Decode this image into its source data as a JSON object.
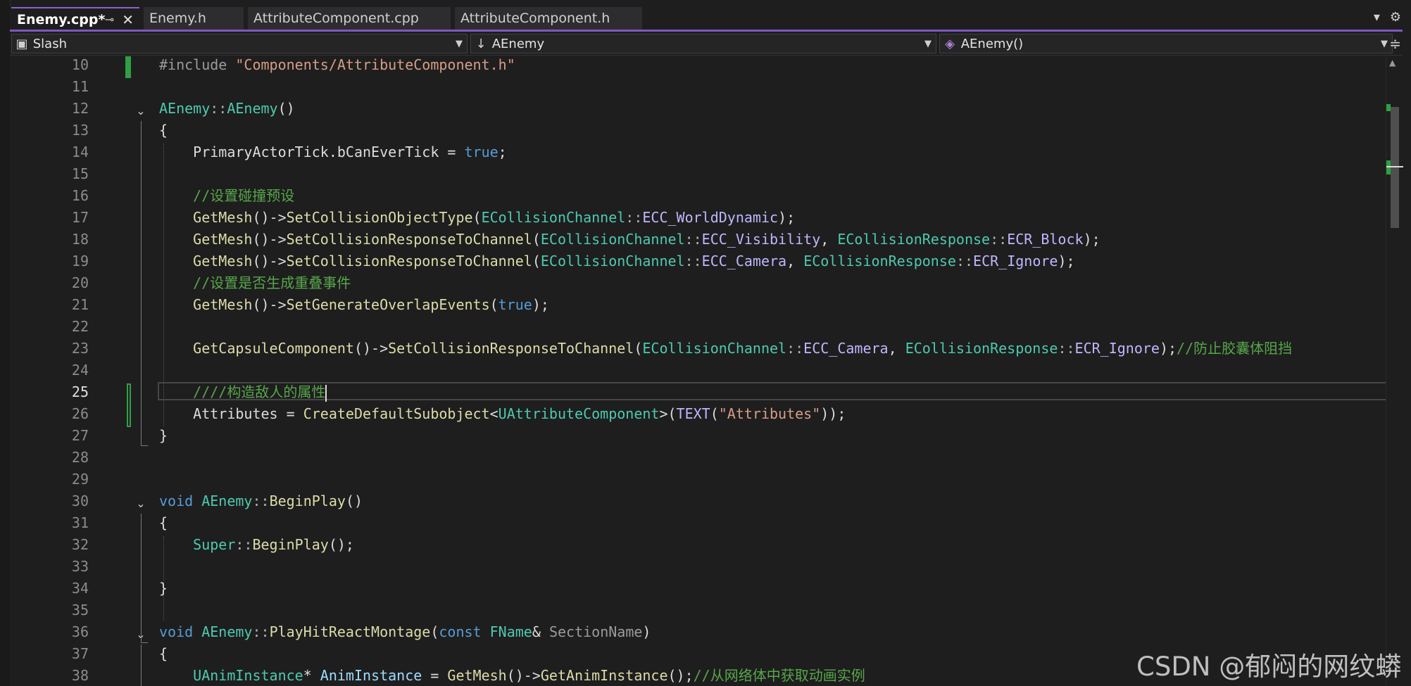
{
  "tabs": [
    {
      "label": "Enemy.cpp*",
      "active": true
    },
    {
      "label": "Enemy.h",
      "active": false
    },
    {
      "label": "AttributeComponent.cpp",
      "active": false
    },
    {
      "label": "AttributeComponent.h",
      "active": false
    }
  ],
  "tab_icons": {
    "pin": "pin-icon",
    "close": "close-icon",
    "overflow": "chevron-down-icon",
    "settings": "gear-icon"
  },
  "nav": {
    "project": "Slash",
    "scope": "AEnemy",
    "member": "AEnemy()"
  },
  "editor": {
    "current_line": 25,
    "lines": [
      {
        "n": 10,
        "tokens": [
          [
            "pr",
            "#include "
          ],
          [
            "s",
            "\"Components/AttributeComponent.h\""
          ]
        ]
      },
      {
        "n": 11,
        "tokens": []
      },
      {
        "n": 12,
        "tokens": [
          [
            "t",
            "AEnemy"
          ],
          [
            "op",
            "::"
          ],
          [
            "t",
            "AEnemy"
          ],
          [
            "p",
            "()"
          ]
        ]
      },
      {
        "n": 13,
        "tokens": [
          [
            "p",
            "{"
          ]
        ]
      },
      {
        "n": 14,
        "tokens": [
          [
            "p",
            "    PrimaryActorTick.bCanEverTick = "
          ],
          [
            "k",
            "true"
          ],
          [
            "p",
            ";"
          ]
        ]
      },
      {
        "n": 15,
        "tokens": []
      },
      {
        "n": 16,
        "tokens": [
          [
            "c",
            "    //设置碰撞预设"
          ]
        ]
      },
      {
        "n": 17,
        "tokens": [
          [
            "f",
            "    GetMesh"
          ],
          [
            "p",
            "()->"
          ],
          [
            "f",
            "SetCollisionObjectType"
          ],
          [
            "p",
            "("
          ],
          [
            "t",
            "ECollisionChannel"
          ],
          [
            "op",
            "::"
          ],
          [
            "m",
            "ECC_WorldDynamic"
          ],
          [
            "p",
            ");"
          ]
        ]
      },
      {
        "n": 18,
        "tokens": [
          [
            "f",
            "    GetMesh"
          ],
          [
            "p",
            "()->"
          ],
          [
            "f",
            "SetCollisionResponseToChannel"
          ],
          [
            "p",
            "("
          ],
          [
            "t",
            "ECollisionChannel"
          ],
          [
            "op",
            "::"
          ],
          [
            "m",
            "ECC_Visibility"
          ],
          [
            "p",
            ", "
          ],
          [
            "t",
            "ECollisionResponse"
          ],
          [
            "op",
            "::"
          ],
          [
            "m",
            "ECR_Block"
          ],
          [
            "p",
            ");"
          ]
        ]
      },
      {
        "n": 19,
        "tokens": [
          [
            "f",
            "    GetMesh"
          ],
          [
            "p",
            "()->"
          ],
          [
            "f",
            "SetCollisionResponseToChannel"
          ],
          [
            "p",
            "("
          ],
          [
            "t",
            "ECollisionChannel"
          ],
          [
            "op",
            "::"
          ],
          [
            "m",
            "ECC_Camera"
          ],
          [
            "p",
            ", "
          ],
          [
            "t",
            "ECollisionResponse"
          ],
          [
            "op",
            "::"
          ],
          [
            "m",
            "ECR_Ignore"
          ],
          [
            "p",
            ");"
          ]
        ]
      },
      {
        "n": 20,
        "tokens": [
          [
            "c",
            "    //设置是否生成重叠事件"
          ]
        ]
      },
      {
        "n": 21,
        "tokens": [
          [
            "f",
            "    GetMesh"
          ],
          [
            "p",
            "()->"
          ],
          [
            "f",
            "SetGenerateOverlapEvents"
          ],
          [
            "p",
            "("
          ],
          [
            "k",
            "true"
          ],
          [
            "p",
            ");"
          ]
        ]
      },
      {
        "n": 22,
        "tokens": []
      },
      {
        "n": 23,
        "tokens": [
          [
            "f",
            "    GetCapsuleComponent"
          ],
          [
            "p",
            "()->"
          ],
          [
            "f",
            "SetCollisionResponseToChannel"
          ],
          [
            "p",
            "("
          ],
          [
            "t",
            "ECollisionChannel"
          ],
          [
            "op",
            "::"
          ],
          [
            "m",
            "ECC_Camera"
          ],
          [
            "p",
            ", "
          ],
          [
            "t",
            "ECollisionResponse"
          ],
          [
            "op",
            "::"
          ],
          [
            "m",
            "ECR_Ignore"
          ],
          [
            "p",
            ");"
          ],
          [
            "c",
            "//防止胶囊体阻挡"
          ]
        ]
      },
      {
        "n": 24,
        "tokens": []
      },
      {
        "n": 25,
        "tokens": [
          [
            "c",
            "    ////构造敌人的属性"
          ]
        ]
      },
      {
        "n": 26,
        "tokens": [
          [
            "p",
            "    Attributes = "
          ],
          [
            "f",
            "CreateDefaultSubobject"
          ],
          [
            "p",
            "<"
          ],
          [
            "t",
            "UAttributeComponent"
          ],
          [
            "p",
            ">("
          ],
          [
            "m",
            "TEXT"
          ],
          [
            "p",
            "("
          ],
          [
            "s",
            "\"Attributes\""
          ],
          [
            "p",
            "));"
          ]
        ]
      },
      {
        "n": 27,
        "tokens": [
          [
            "p",
            "}"
          ]
        ]
      },
      {
        "n": 28,
        "tokens": []
      },
      {
        "n": 29,
        "tokens": []
      },
      {
        "n": 30,
        "tokens": [
          [
            "k",
            "void "
          ],
          [
            "t",
            "AEnemy"
          ],
          [
            "op",
            "::"
          ],
          [
            "f",
            "BeginPlay"
          ],
          [
            "p",
            "()"
          ]
        ]
      },
      {
        "n": 31,
        "tokens": [
          [
            "p",
            "{"
          ]
        ]
      },
      {
        "n": 32,
        "tokens": [
          [
            "t",
            "    Super"
          ],
          [
            "op",
            "::"
          ],
          [
            "f",
            "BeginPlay"
          ],
          [
            "p",
            "();"
          ]
        ]
      },
      {
        "n": 33,
        "tokens": []
      },
      {
        "n": 34,
        "tokens": [
          [
            "p",
            "}"
          ]
        ]
      },
      {
        "n": 35,
        "tokens": []
      },
      {
        "n": 36,
        "tokens": [
          [
            "k",
            "void "
          ],
          [
            "t",
            "AEnemy"
          ],
          [
            "op",
            "::"
          ],
          [
            "f",
            "PlayHitReactMontage"
          ],
          [
            "p",
            "("
          ],
          [
            "k",
            "const "
          ],
          [
            "t",
            "FName"
          ],
          [
            "p",
            "& "
          ],
          [
            "pr",
            "SectionName"
          ],
          [
            "p",
            ")"
          ]
        ]
      },
      {
        "n": 37,
        "tokens": [
          [
            "p",
            "{"
          ]
        ]
      },
      {
        "n": 38,
        "tokens": [
          [
            "t",
            "    UAnimInstance"
          ],
          [
            "p",
            "* "
          ],
          [
            "g",
            "AnimInstance"
          ],
          [
            "p",
            " = "
          ],
          [
            "f",
            "GetMesh"
          ],
          [
            "p",
            "()->"
          ],
          [
            "f",
            "GetAnimInstance"
          ],
          [
            "p",
            "();"
          ],
          [
            "c",
            "//从网络体中获取动画实例"
          ]
        ]
      }
    ]
  },
  "watermark": "CSDN @郁闷的网纹蟒"
}
